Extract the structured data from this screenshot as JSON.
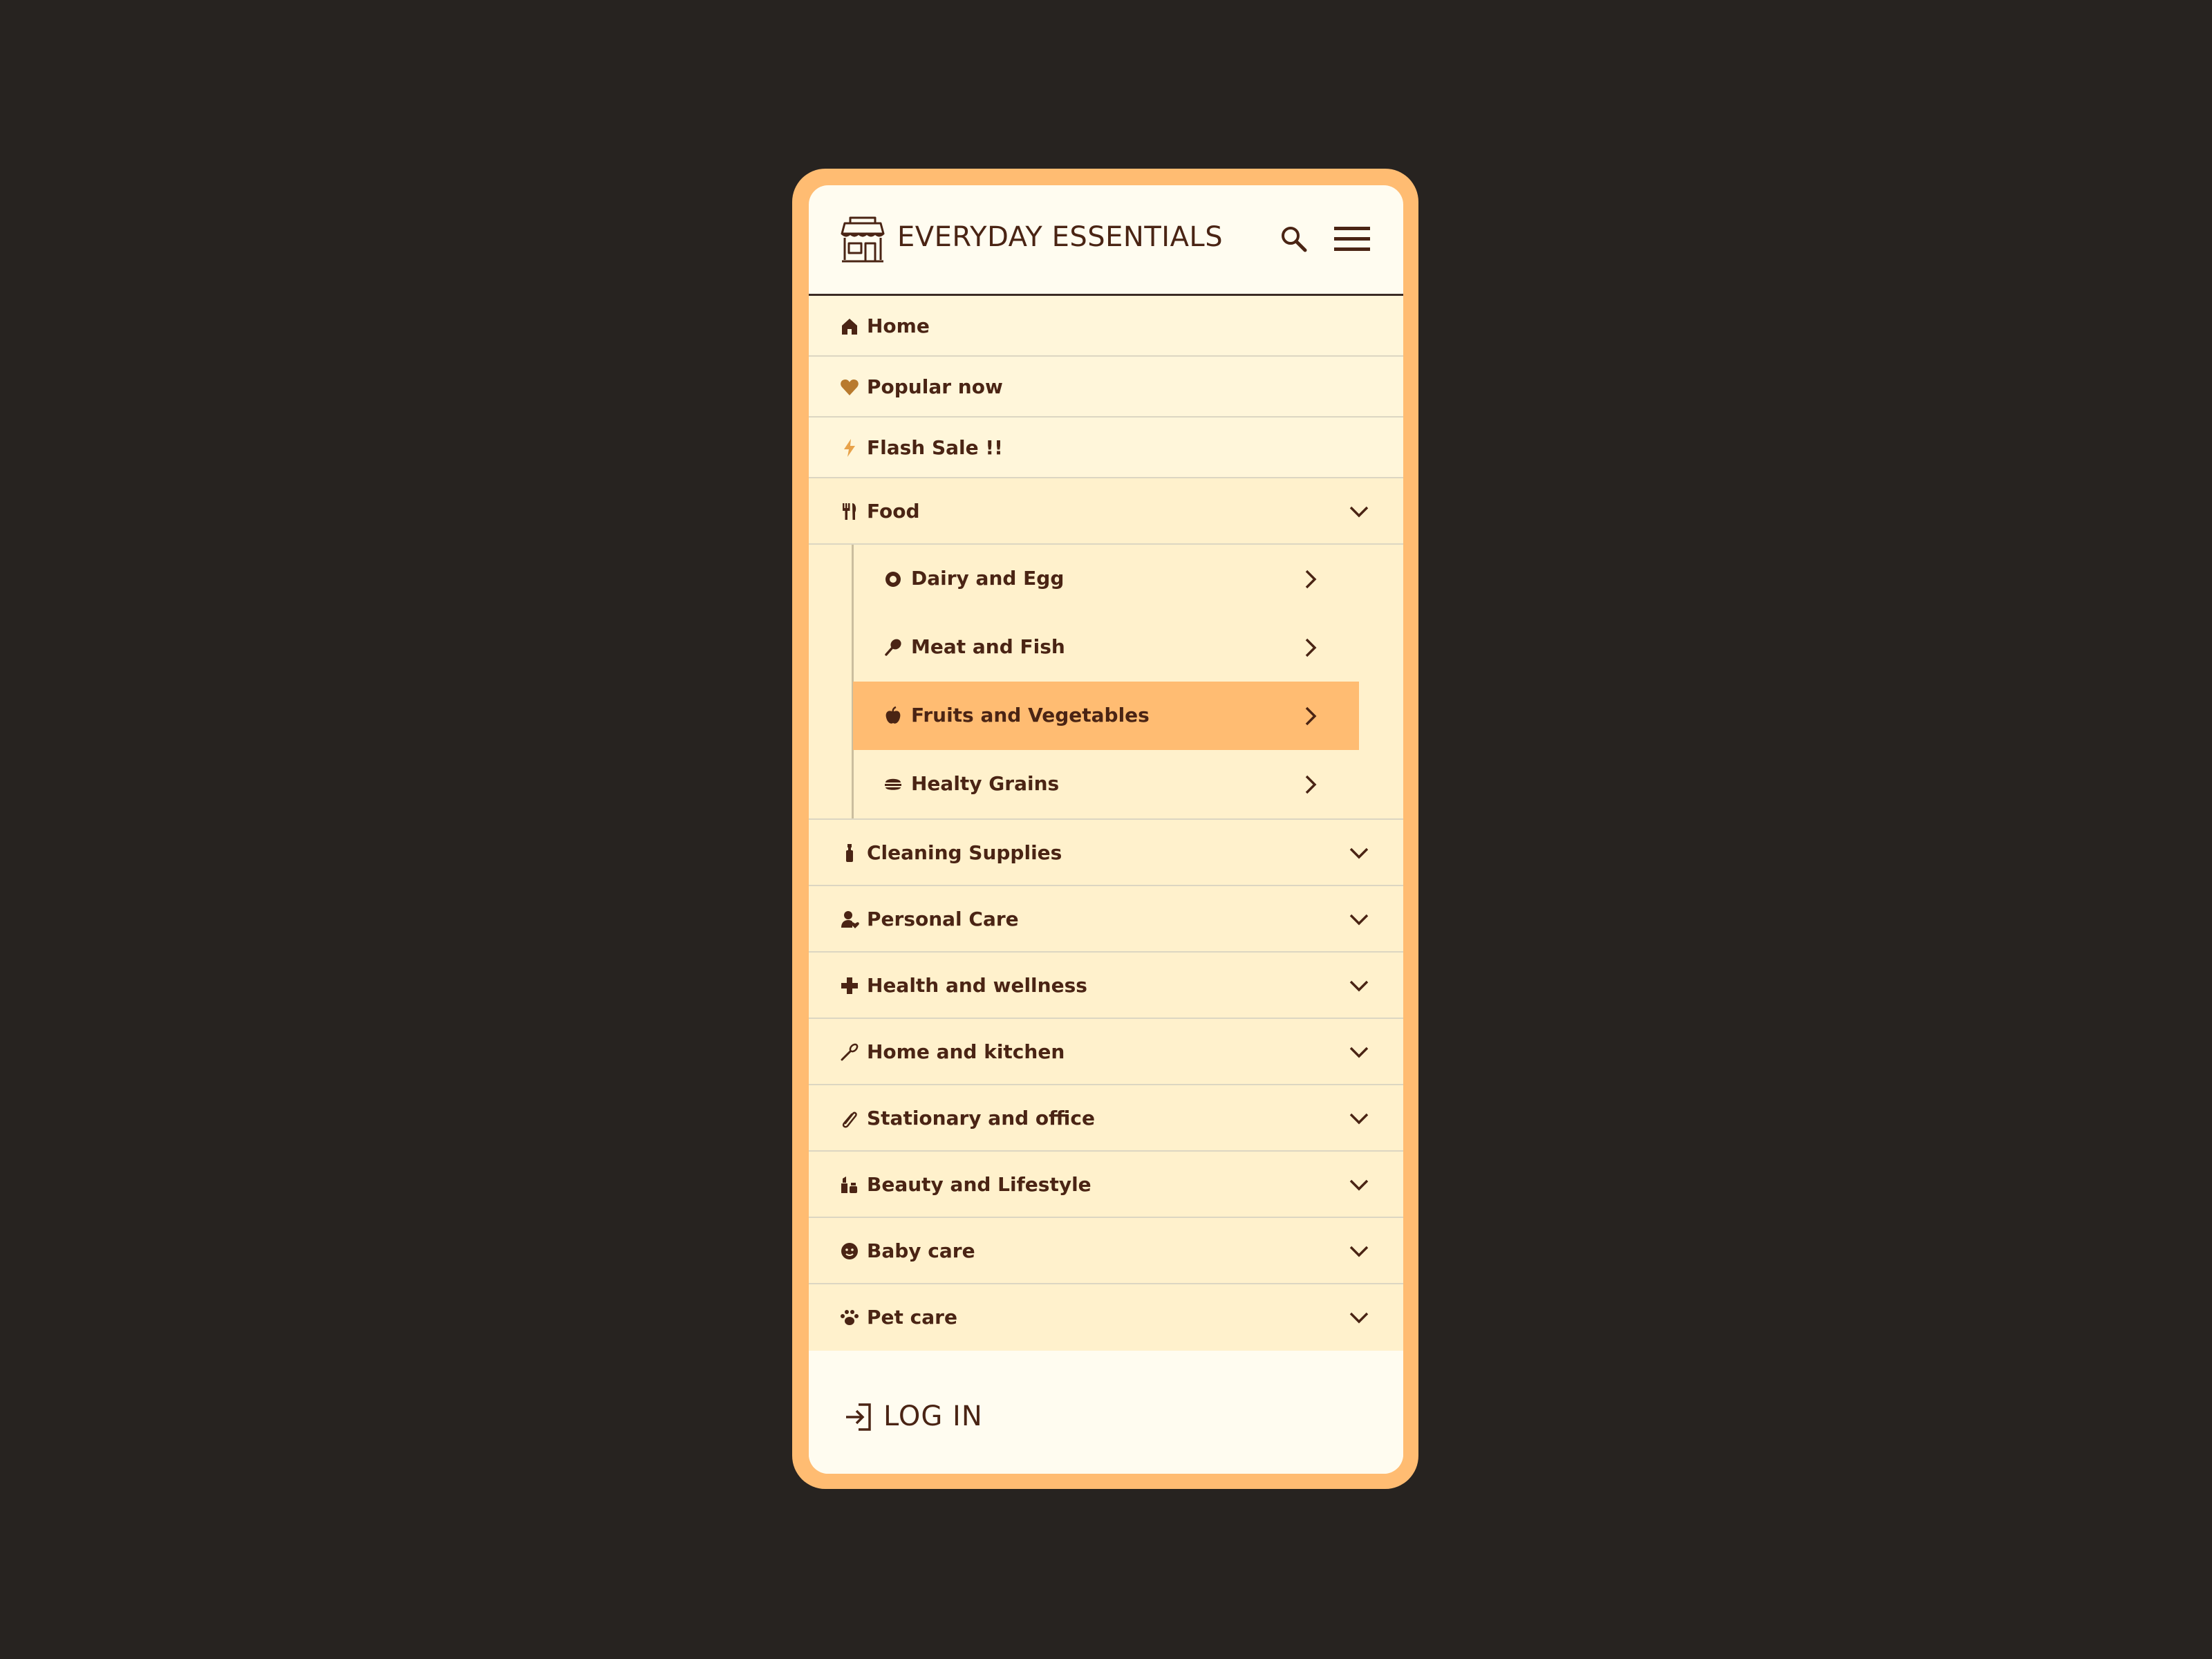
{
  "header": {
    "brand": "EVERYDAY ESSENTIALS",
    "logo_icon": "storefront-icon",
    "search_icon": "search-icon",
    "menu_icon": "hamburger-menu-icon"
  },
  "top_items": [
    {
      "label": "Home",
      "icon": "home-icon"
    },
    {
      "label": "Popular now",
      "icon": "heart-icon"
    },
    {
      "label": "Flash Sale !!",
      "icon": "bolt-icon"
    }
  ],
  "food": {
    "label": "Food",
    "icon": "utensils-icon",
    "expanded": true,
    "subitems": [
      {
        "label": "Dairy and Egg",
        "icon": "egg-icon"
      },
      {
        "label": "Meat and Fish",
        "icon": "drumstick-icon"
      },
      {
        "label": "Fruits and Vegetables",
        "icon": "apple-icon",
        "selected": true
      },
      {
        "label": "Healty Grains",
        "icon": "burger-icon"
      }
    ]
  },
  "categories": [
    {
      "label": "Cleaning Supplies",
      "icon": "spray-bottle-icon"
    },
    {
      "label": "Personal Care",
      "icon": "person-heart-icon"
    },
    {
      "label": "Health and wellness",
      "icon": "medical-cross-icon"
    },
    {
      "label": "Home and kitchen",
      "icon": "whisk-icon"
    },
    {
      "label": "Stationary and office",
      "icon": "paperclip-icon"
    },
    {
      "label": "Beauty and Lifestyle",
      "icon": "lipstick-icon"
    },
    {
      "label": "Baby care",
      "icon": "baby-face-icon"
    },
    {
      "label": "Pet care",
      "icon": "paw-icon"
    }
  ],
  "footer": {
    "login_label": "LOG IN",
    "login_icon": "login-icon"
  },
  "colors": {
    "background": "#272320",
    "frame": "#FFBC72",
    "screen": "#FFFCF0",
    "top_row": "#FFF6DA",
    "category_row": "#FFF1CC",
    "selected": "#FFBC72",
    "text": "#4A2414",
    "accent_icon": "#B87A2E"
  }
}
